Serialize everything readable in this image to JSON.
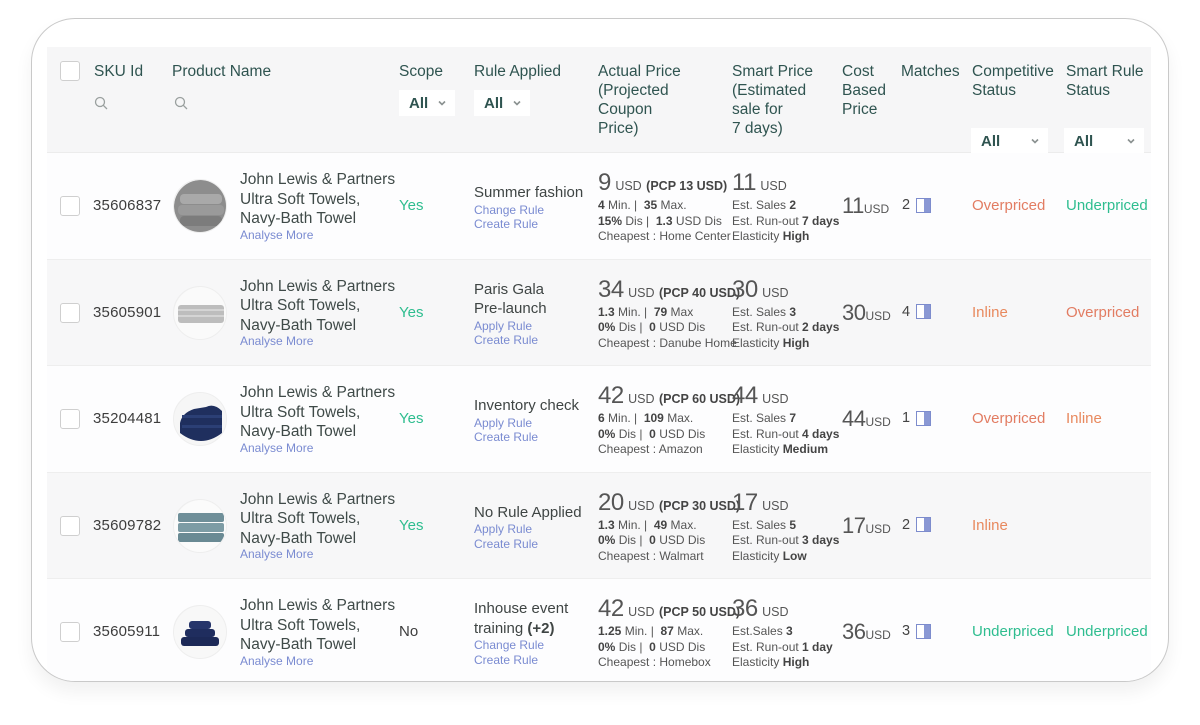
{
  "colors": {
    "header_text": "#2f5450",
    "link": "#7a8bd1",
    "positive": "#2ebd8f",
    "overpriced": "#e27c62",
    "inline": "#e8895e",
    "match_icon": "#8a98d4"
  },
  "header": {
    "sku": "SKU Id",
    "product": "Product Name",
    "scope": "Scope",
    "rule": "Rule Applied",
    "actual_price": [
      "Actual Price",
      "(Projected",
      "Coupon",
      "Price)"
    ],
    "smart_price": [
      "Smart Price",
      "(Estimated",
      "sale for",
      "7 days)"
    ],
    "cost": [
      "Cost",
      "Based",
      "Price"
    ],
    "matches": "Matches",
    "competitive": [
      "Competitive",
      "Status"
    ],
    "smart_rule": [
      "Smart Rule",
      "Status"
    ],
    "filters": {
      "scope": "All",
      "rule": "All",
      "competitive": "All",
      "smart_rule": "All"
    },
    "icons": {
      "sku_search": "search-icon",
      "product_search": "search-icon",
      "filter_chevron": "chevron-down-icon"
    }
  },
  "rows": [
    {
      "sku": "35606837",
      "image": "grey-towel-stack",
      "name": [
        "John Lewis & Partners",
        "Ultra Soft Towels,",
        "Navy-Bath Towel"
      ],
      "analyse": "Analyse More",
      "scope": "Yes",
      "rule": [
        "Summer fashion"
      ],
      "rule_links": [
        "Change Rule",
        "Create Rule"
      ],
      "actual": {
        "price": "9",
        "currency": "USD",
        "pcp": "(PCP 13 USD)",
        "min": "4",
        "min_label": "Min. |",
        "max": "35",
        "max_label": "Max.",
        "dis_pct": "15%",
        "dis_pct_label": "Dis |",
        "dis_usd": "1.3",
        "dis_usd_label": "USD Dis",
        "cheapest": "Cheapest : Home Center"
      },
      "smart": {
        "price": "11",
        "currency": "USD",
        "sales_label": "Est. Sales",
        "sales": "2",
        "runout_label": "Est. Run-out",
        "runout": "7 days",
        "elasticity_label": "Elasticity",
        "elasticity": "High"
      },
      "cost": {
        "price": "11",
        "currency": "USD"
      },
      "matches": "2",
      "competitive": {
        "label": "Overpriced",
        "kind": "over"
      },
      "smart_rule": {
        "label": "Underpriced",
        "kind": "under"
      }
    },
    {
      "sku": "35605901",
      "image": "light-grey-folded-towel",
      "name": [
        "John Lewis & Partners",
        "Ultra Soft Towels,",
        "Navy-Bath Towel"
      ],
      "analyse": "Analyse More",
      "scope": "Yes",
      "rule": [
        "Paris Gala",
        "Pre-launch"
      ],
      "rule_links": [
        "Apply Rule",
        "Create Rule"
      ],
      "actual": {
        "price": "34",
        "currency": "USD",
        "pcp": "(PCP 40 USD)",
        "min": "1.3",
        "min_label": "Min. |",
        "max": "79",
        "max_label": "Max",
        "dis_pct": "0%",
        "dis_pct_label": "Dis |",
        "dis_usd": "0",
        "dis_usd_label": "USD Dis",
        "cheapest": "Cheapest : Danube Home"
      },
      "smart": {
        "price": "30",
        "currency": "USD",
        "sales_label": "Est. Sales",
        "sales": "3",
        "runout_label": "Est. Run-out",
        "runout": "2 days",
        "elasticity_label": "Elasticity",
        "elasticity": "High"
      },
      "cost": {
        "price": "30",
        "currency": "USD"
      },
      "matches": "4",
      "competitive": {
        "label": "Inline",
        "kind": "inline"
      },
      "smart_rule": {
        "label": "Overpriced",
        "kind": "over"
      }
    },
    {
      "sku": "35204481",
      "image": "navy-towel-stack",
      "name": [
        "John Lewis & Partners",
        "Ultra Soft Towels,",
        "Navy-Bath Towel"
      ],
      "analyse": "Analyse More",
      "scope": "Yes",
      "rule": [
        "Inventory check"
      ],
      "rule_links": [
        "Apply Rule",
        "Create Rule"
      ],
      "actual": {
        "price": "42",
        "currency": "USD",
        "pcp": "(PCP 60 USD)",
        "min": "6",
        "min_label": "Min. |",
        "max": "109",
        "max_label": "Max.",
        "dis_pct": "0%",
        "dis_pct_label": "Dis |",
        "dis_usd": "0",
        "dis_usd_label": "USD Dis",
        "cheapest": "Cheapest : Amazon"
      },
      "smart": {
        "price": "44",
        "currency": "USD",
        "sales_label": "Est. Sales",
        "sales": "7",
        "runout_label": "Est. Run-out",
        "runout": "4 days",
        "elasticity_label": "Elasticity",
        "elasticity": "Medium"
      },
      "cost": {
        "price": "44",
        "currency": "USD"
      },
      "matches": "1",
      "competitive": {
        "label": "Overpriced",
        "kind": "over"
      },
      "smart_rule": {
        "label": "Inline",
        "kind": "inline"
      }
    },
    {
      "sku": "35609782",
      "image": "teal-towel-stack",
      "name": [
        "John Lewis & Partners",
        "Ultra Soft Towels,",
        "Navy-Bath Towel"
      ],
      "analyse": "Analyse More",
      "scope": "Yes",
      "rule": [
        "No Rule Applied"
      ],
      "rule_links": [
        "Apply Rule",
        "Create Rule"
      ],
      "actual": {
        "price": "20",
        "currency": "USD",
        "pcp": "(PCP 30 USD)",
        "min": "1.3",
        "min_label": "Min. |",
        "max": "49",
        "max_label": "Max.",
        "dis_pct": "0%",
        "dis_pct_label": "Dis |",
        "dis_usd": "0",
        "dis_usd_label": "USD Dis",
        "cheapest": "Cheapest : Walmart"
      },
      "smart": {
        "price": "17",
        "currency": "USD",
        "sales_label": "Est. Sales",
        "sales": "5",
        "runout_label": "Est. Run-out",
        "runout": "3 days",
        "elasticity_label": "Elasticity",
        "elasticity": "Low"
      },
      "cost": {
        "price": "17",
        "currency": "USD"
      },
      "matches": "2",
      "competitive": {
        "label": "Inline",
        "kind": "inline"
      },
      "smart_rule": {
        "label": "",
        "kind": "none"
      }
    },
    {
      "sku": "35605911",
      "image": "navy-towel-stack-small",
      "name": [
        "John Lewis & Partners",
        "Ultra Soft Towels,",
        "Navy-Bath Towel"
      ],
      "analyse": "Analyse More",
      "scope": "No",
      "rule": [
        "Inhouse event",
        "training"
      ],
      "rule_extra": "(+2)",
      "rule_links": [
        "Change Rule",
        "Create Rule"
      ],
      "actual": {
        "price": "42",
        "currency": "USD",
        "pcp": "(PCP 50 USD)",
        "min": "1.25",
        "min_label": "Min. |",
        "max": "87",
        "max_label": "Max.",
        "dis_pct": "0%",
        "dis_pct_label": "Dis |",
        "dis_usd": "0",
        "dis_usd_label": "USD Dis",
        "cheapest": "Cheapest : Homebox"
      },
      "smart": {
        "price": "36",
        "currency": "USD",
        "sales_label": "Est.Sales",
        "sales": "3",
        "runout_label": "Est. Run-out",
        "runout": "1 day",
        "elasticity_label": "Elasticity",
        "elasticity": "High"
      },
      "cost": {
        "price": "36",
        "currency": "USD"
      },
      "matches": "3",
      "competitive": {
        "label": "Underpriced",
        "kind": "under"
      },
      "smart_rule": {
        "label": "Underpriced",
        "kind": "under"
      }
    }
  ]
}
